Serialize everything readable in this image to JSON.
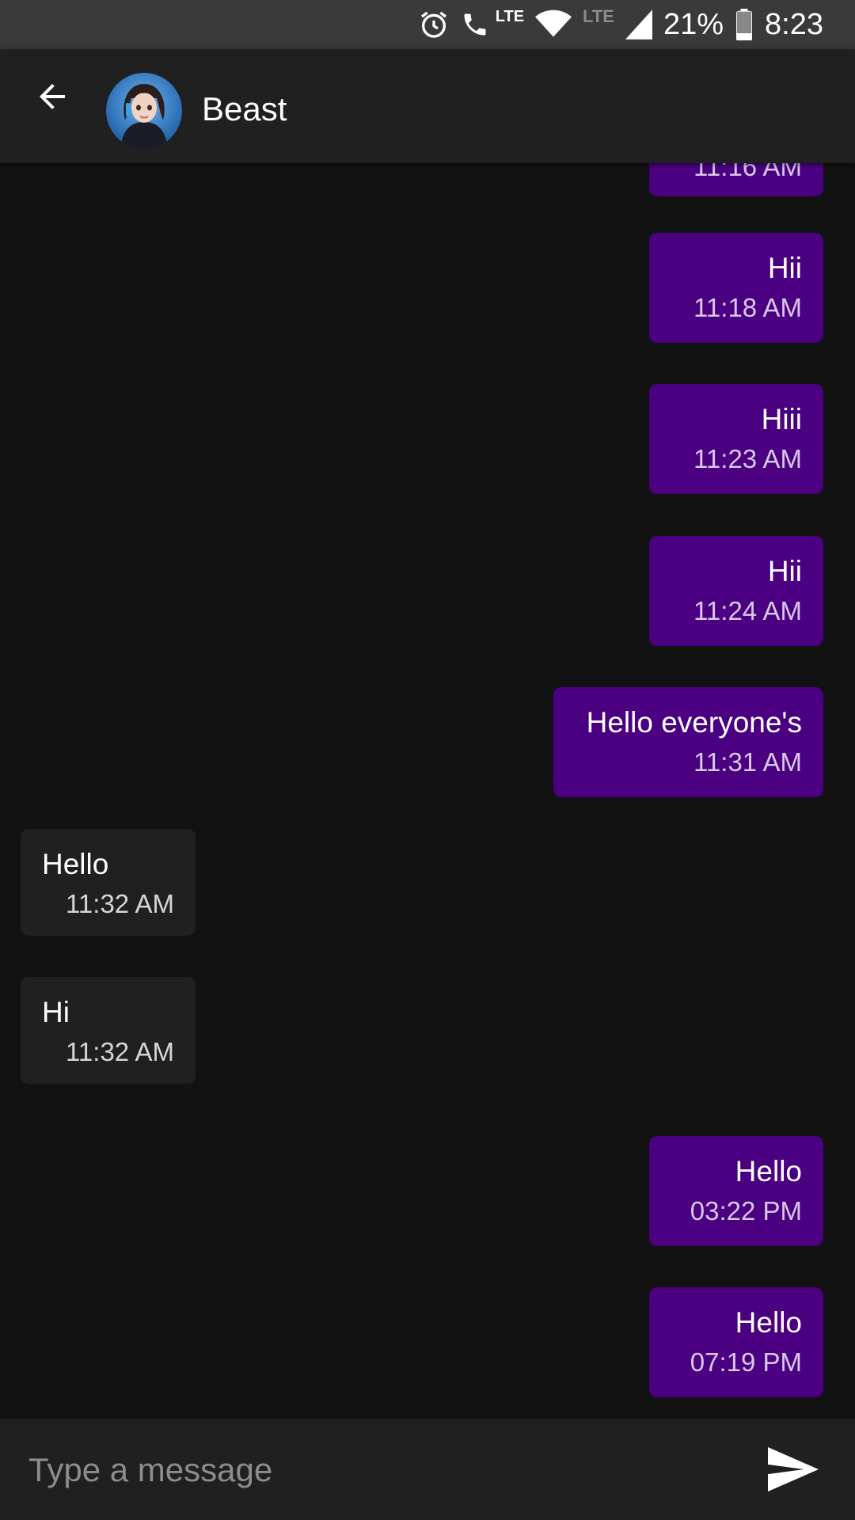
{
  "status_bar": {
    "network_label": "LTE",
    "network_label_2": "LTE",
    "battery": "21%",
    "time": "8:23"
  },
  "header": {
    "contact_name": "Beast"
  },
  "messages": [
    {
      "direction": "out",
      "text": "",
      "time": "11:16 AM"
    },
    {
      "direction": "out",
      "text": "Hii",
      "time": "11:18 AM"
    },
    {
      "direction": "out",
      "text": "Hiii",
      "time": "11:23 AM"
    },
    {
      "direction": "out",
      "text": "Hii",
      "time": "11:24 AM"
    },
    {
      "direction": "out",
      "text": "Hello everyone's",
      "time": "11:31 AM"
    },
    {
      "direction": "in",
      "text": "Hello",
      "time": "11:32 AM"
    },
    {
      "direction": "in",
      "text": "Hi",
      "time": "11:32 AM"
    },
    {
      "direction": "out",
      "text": "Hello",
      "time": "03:22 PM"
    },
    {
      "direction": "out",
      "text": "Hello",
      "time": "07:19 PM"
    }
  ],
  "composer": {
    "placeholder": "Type a message",
    "value": ""
  },
  "icons": {
    "back": "arrow-back-icon",
    "send": "send-icon",
    "alarm": "alarm-icon",
    "call": "wifi-call-icon",
    "wifi": "wifi-icon",
    "signal": "signal-icon",
    "battery": "battery-icon"
  },
  "colors": {
    "outgoing_bubble": "#4a0080",
    "incoming_bubble": "#202020",
    "background": "#121212",
    "app_bar": "#202020"
  }
}
